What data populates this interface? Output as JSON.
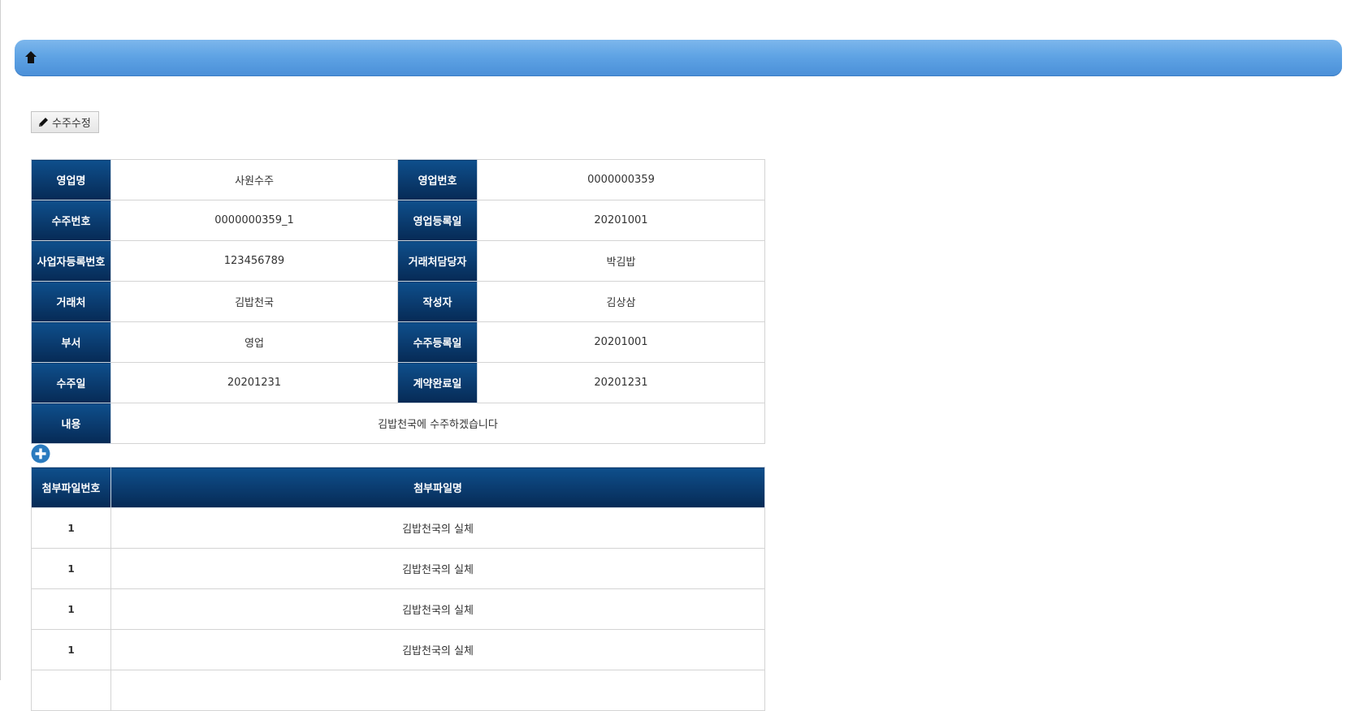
{
  "toolbar": {
    "home_icon": "home-icon",
    "edit_label": "수주수정",
    "edit_icon": "pencil-icon",
    "add_icon": "plus-circle-icon"
  },
  "colors": {
    "topbar": "#5fa3e4",
    "header_cell": "#0b3e73",
    "add_button": "#2a7bbf"
  },
  "info": {
    "rows": [
      {
        "h1": "영업명",
        "v1": "사원수주",
        "h2": "영업번호",
        "v2": "0000000359"
      },
      {
        "h1": "수주번호",
        "v1": "0000000359_1",
        "h2": "영업등록일",
        "v2": "20201001"
      },
      {
        "h1": "사업자등록번호",
        "v1": "123456789",
        "h2": "거래처담당자",
        "v2": "박김밥"
      },
      {
        "h1": "거래처",
        "v1": "김밥천국",
        "h2": "작성자",
        "v2": "김상삼"
      },
      {
        "h1": "부서",
        "v1": "영업",
        "h2": "수주등록일",
        "v2": "20201001"
      },
      {
        "h1": "수주일",
        "v1": "20201231",
        "h2": "계약완료일",
        "v2": "20201231"
      }
    ],
    "content_label": "내용",
    "content_value": "김밥천국에 수주하겠습니다"
  },
  "files": {
    "headers": [
      "첨부파일번호",
      "첨부파일명"
    ],
    "rows": [
      {
        "no": "1",
        "name": "김밥천국의 실체"
      },
      {
        "no": "1",
        "name": "김밥천국의 실체"
      },
      {
        "no": "1",
        "name": "김밥천국의 실체"
      },
      {
        "no": "1",
        "name": "김밥천국의 실체"
      },
      {
        "no": "",
        "name": ""
      }
    ]
  }
}
